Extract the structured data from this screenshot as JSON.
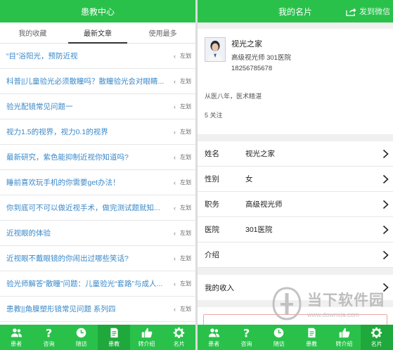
{
  "left": {
    "title": "患教中心",
    "tabs": [
      {
        "label": "我的收藏"
      },
      {
        "label": "最新文章"
      },
      {
        "label": "使用最多"
      }
    ],
    "articles": [
      {
        "title": "“目”浴阳光，预防近视",
        "hint": "左划"
      },
      {
        "title": "科普||儿童验光必须散瞳吗？散瞳验光会对眼睛...",
        "hint": "左划"
      },
      {
        "title": "验光配镜常见问题一",
        "hint": "左划"
      },
      {
        "title": "视力1.5的视界，视力0.1的视界",
        "hint": "左划"
      },
      {
        "title": "最新研究，紫色能抑制近视你知道吗?",
        "hint": "左划"
      },
      {
        "title": "睡前喜欢玩手机的你需要get办法！",
        "hint": "左划"
      },
      {
        "title": "你到底可不可以做近视手术，做完测试题就知...",
        "hint": "左划"
      },
      {
        "title": "近视眼的体验",
        "hint": "左划"
      },
      {
        "title": "近视眼不戴眼镜的你闹出过哪些笑话?",
        "hint": "左划"
      },
      {
        "title": "验光师解答“散瞳”问题：儿童验光“套路”与成人...",
        "hint": "左划"
      },
      {
        "title": "患教||角膜塑形镜常见问题 系列四",
        "hint": "左划"
      }
    ],
    "nav": [
      {
        "label": "患者",
        "icon": "patients-icon"
      },
      {
        "label": "咨询",
        "icon": "question-icon"
      },
      {
        "label": "随访",
        "icon": "clock-icon"
      },
      {
        "label": "患教",
        "icon": "document-icon"
      },
      {
        "label": "转介绍",
        "icon": "thumbs-up-icon"
      },
      {
        "label": "名片",
        "icon": "gear-icon"
      }
    ]
  },
  "right": {
    "title": "我的名片",
    "share_label": "发到微信",
    "profile": {
      "name": "视光之家",
      "position": "高级视光师 301医院",
      "phone": "18256785678",
      "desc": "从医八年，医术精湛",
      "follow": "5 关注"
    },
    "details": [
      {
        "label": "姓名",
        "value": "视光之家"
      },
      {
        "label": "性别",
        "value": "女"
      },
      {
        "label": "职务",
        "value": "高级视光师"
      },
      {
        "label": "医院",
        "value": "301医院"
      },
      {
        "label": "介绍",
        "value": ""
      }
    ],
    "income_label": "我的收入",
    "nav": [
      {
        "label": "患者",
        "icon": "patients-icon"
      },
      {
        "label": "咨询",
        "icon": "question-icon"
      },
      {
        "label": "随访",
        "icon": "clock-icon"
      },
      {
        "label": "患教",
        "icon": "document-icon"
      },
      {
        "label": "转介绍",
        "icon": "thumbs-up-icon"
      },
      {
        "label": "名片",
        "icon": "gear-icon"
      }
    ]
  },
  "watermark": {
    "text_cn": "当下软件园",
    "text_en": "www.downxia.com"
  },
  "colors": {
    "brand_green": "#29c14a",
    "link_blue": "#3a88c9"
  }
}
